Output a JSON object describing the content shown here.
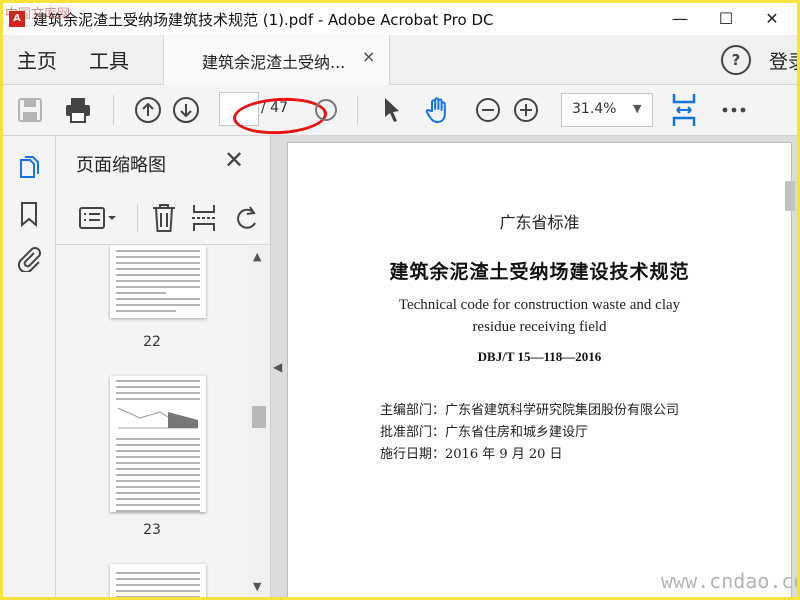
{
  "window": {
    "title": "建筑余泥渣土受纳场建筑技术规范 (1).pdf - Adobe Acrobat Pro DC",
    "minimize": "—",
    "maximize": "☐",
    "close": "✕",
    "overlay_text": "中国文库网"
  },
  "nav": {
    "home": "主页",
    "tools": "工具",
    "help": "?",
    "login": "登录"
  },
  "tab": {
    "label": "建筑余泥渣土受纳...",
    "close": "×"
  },
  "toolbar": {
    "page_current": "",
    "page_total": "/ 47",
    "zoom": "31.4%",
    "zoom_caret": "▼"
  },
  "thumbnails": {
    "title": "页面缩略图",
    "close": "✕",
    "pages": [
      {
        "number": "22"
      },
      {
        "number": "23"
      }
    ]
  },
  "document": {
    "standard_label": "广东省标准",
    "title_cn": "建筑余泥渣土受纳场建设技术规范",
    "title_en_line1": "Technical code for construction waste and clay",
    "title_en_line2": "residue receiving field",
    "code": "DBJ/T 15—118—2016",
    "editor": "主编部门：广东省建筑科学研究院集团股份有限公司",
    "approver": "批准部门：广东省住房和城乡建设厅",
    "effective_date": "施行日期：2016 年 9 月 20 日"
  },
  "watermark": "www.cndao.com",
  "colors": {
    "annotation": "#e81414",
    "accent": "#1473e6",
    "frame": "#f6e23a"
  }
}
